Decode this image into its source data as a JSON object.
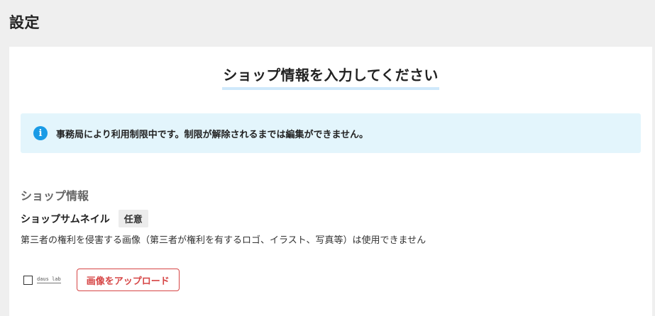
{
  "page": {
    "title": "設定"
  },
  "form": {
    "heading": "ショップ情報を入力してください"
  },
  "notice": {
    "icon": "info-icon",
    "icon_glyph": "i",
    "text": "事務局により利用制限中です。制限が解除されるまでは編集ができません。",
    "background_color": "#e3f5fc",
    "icon_color": "#1a9be6"
  },
  "shop_info": {
    "section_title": "ショップ情報",
    "thumbnail": {
      "label": "ショップサムネイル",
      "badge": "任意",
      "note": "第三者の権利を侵害する画像（第三者が権利を有するロゴ、イラスト、写真等）は使用できません",
      "logo_text": "daus lab",
      "upload_button": "画像をアップロード",
      "upload_button_color": "#d64545"
    }
  }
}
